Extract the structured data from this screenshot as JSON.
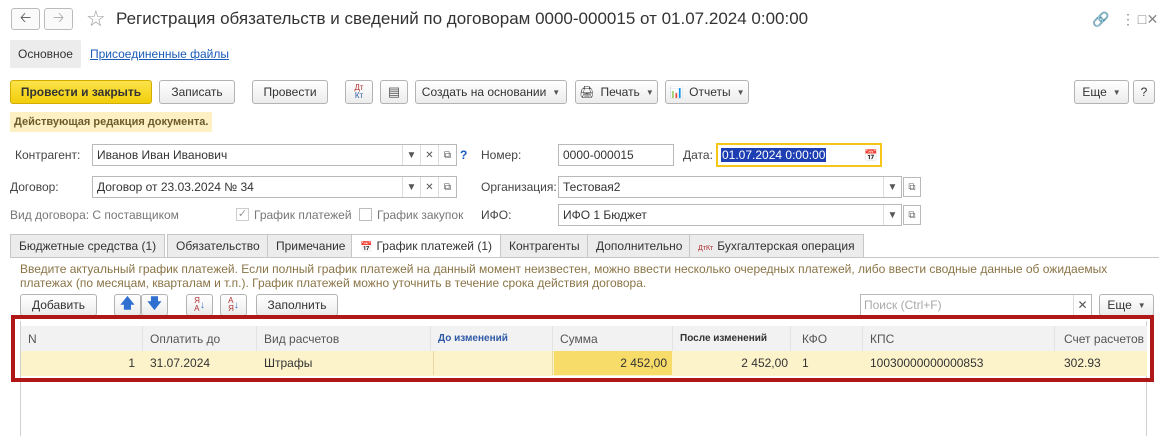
{
  "window": {
    "title": "Регистрация обязательств и сведений по договорам 0000-000015 от 01.07.2024 0:00:00"
  },
  "icons": {
    "back": "arrow-left-icon",
    "forward": "arrow-right-icon",
    "favorite": "star-icon",
    "link": "link-icon",
    "more": "kebab-icon",
    "maximize": "maximize-icon",
    "close": "close-icon"
  },
  "sections": {
    "main": "Основное",
    "files": "Присоединенные файлы"
  },
  "toolbar": {
    "post_close": "Провести и закрыть",
    "save": "Записать",
    "post": "Провести",
    "dt_kt": "Дт Кт",
    "create_based": "Создать на основании",
    "print": "Печать",
    "reports": "Отчеты",
    "more": "Еще",
    "help": "?"
  },
  "notice": "Действующая редакция документа.",
  "form": {
    "contractor_label": "Контрагент:",
    "contractor_value": "Иванов Иван Иванович",
    "help_mark": "?",
    "number_label": "Номер:",
    "number_value": "0000-000015",
    "date_label": "Дата:",
    "date_value": "01.07.2024  0:00:00",
    "contract_label": "Договор:",
    "contract_value": "Договор от 23.03.2024 № 34",
    "org_label": "Организация:",
    "org_value": "Тестовая2",
    "contract_type_text": "Вид договора: С поставщиком",
    "payment_schedule_label": "График платежей",
    "payment_schedule_checked": true,
    "purchase_schedule_label": "График закупок",
    "purchase_schedule_checked": false,
    "ifo_label": "ИФО:",
    "ifo_value": "ИФО 1 Бюджет"
  },
  "tabs": [
    {
      "label": "Бюджетные средства (1)"
    },
    {
      "label": "Обязательство"
    },
    {
      "label": "Примечание"
    },
    {
      "label": "График платежей (1)"
    },
    {
      "label": "Контрагенты"
    },
    {
      "label": "Дополнительно"
    },
    {
      "label": "Бухгалтерская операция"
    }
  ],
  "active_tab": "График платежей (1)",
  "hint_text": "Введите актуальный график платежей. Если полный график платежей на данный момент неизвестен, можно ввести несколько очередных платежей, либо ввести сводные данные об ожидаемых платежах (по месяцам, кварталам и т.п.). График платежей можно уточнить в течение срока действия договора.",
  "table_toolbar": {
    "add": "Добавить",
    "fill": "Заполнить",
    "search_placeholder": "Поиск (Ctrl+F)",
    "more": "Еще"
  },
  "table": {
    "columns": [
      "N",
      "Оплатить до",
      "Вид расчетов",
      "До изменений",
      "Сумма",
      "После изменений",
      "КФО",
      "КПС",
      "Счет расчетов"
    ],
    "rows": [
      {
        "n": "1",
        "pay_by": "31.07.2024",
        "kind": "Штрафы",
        "before": "",
        "sum": "2 452,00",
        "after": "2 452,00",
        "kfo": "1",
        "kps": "10030000000000853",
        "account": "302.93"
      }
    ]
  },
  "colors": {
    "accent_yellow": "#f2cd0a",
    "highlight_red": "#b01717",
    "row_selected": "#fdf3cb",
    "link_blue": "#1a5bb8"
  }
}
